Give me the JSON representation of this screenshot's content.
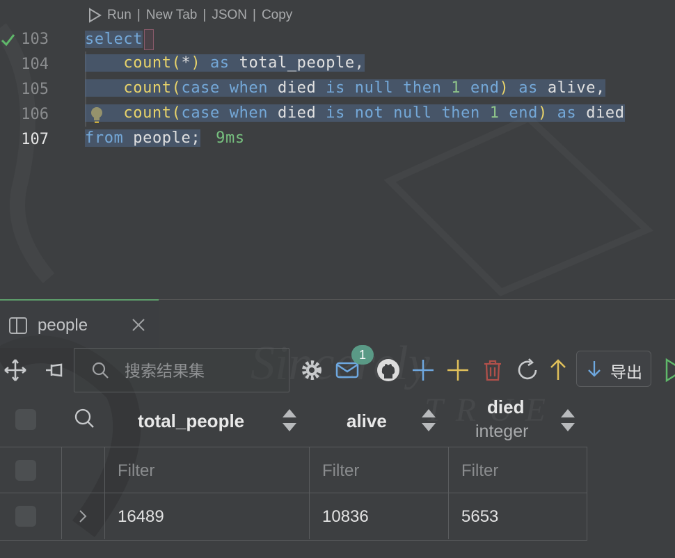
{
  "editor": {
    "codelens": {
      "run": "Run",
      "sep1": "|",
      "new_tab": "New Tab",
      "sep2": "|",
      "json": "JSON",
      "sep3": "|",
      "copy": "Copy"
    },
    "lines": [
      {
        "number": "103",
        "tokens": {
          "t1": "select"
        }
      },
      {
        "number": "104",
        "tokens": {
          "t1": "count(",
          "t2": "*",
          "t3": ")",
          "t4": "as",
          "t5": "total_people,"
        }
      },
      {
        "number": "105",
        "tokens": {
          "t1": "count(",
          "t2": "case",
          "t3": "when",
          "t4": "died",
          "t5": "is",
          "t6": "null",
          "t7": "then",
          "t8": "1",
          "t9": "end",
          "t10": ")",
          "t11": "as",
          "t12": "alive,"
        }
      },
      {
        "number": "106",
        "tokens": {
          "t1": "count(",
          "t2": "case",
          "t3": "when",
          "t4": "died",
          "t5": "is",
          "t6": "not",
          "t7": "null",
          "t8": "then",
          "t9": "1",
          "t10": "end",
          "t11": ")",
          "t12": "as",
          "t13": "died"
        }
      },
      {
        "number": "107",
        "tokens": {
          "t1": "from",
          "t2": "people;",
          "timing": "9ms"
        }
      }
    ],
    "colors": {
      "keyword": "#74a8d8",
      "function": "#e8d36a",
      "number": "#8fc48a",
      "selection": "#506888"
    }
  },
  "panel": {
    "tab_label": "people",
    "search_placeholder": "搜索结果集",
    "notification_count": "1",
    "export_label": "导出",
    "accent": "#5d9e6a"
  },
  "grid": {
    "columns": [
      {
        "name": "total_people",
        "type": ""
      },
      {
        "name": "alive",
        "type": ""
      },
      {
        "name": "died",
        "type": "integer"
      }
    ],
    "filter_placeholder": "Filter",
    "rows": [
      {
        "total_people": "16489",
        "alive": "10836",
        "died": "5653"
      }
    ]
  }
}
